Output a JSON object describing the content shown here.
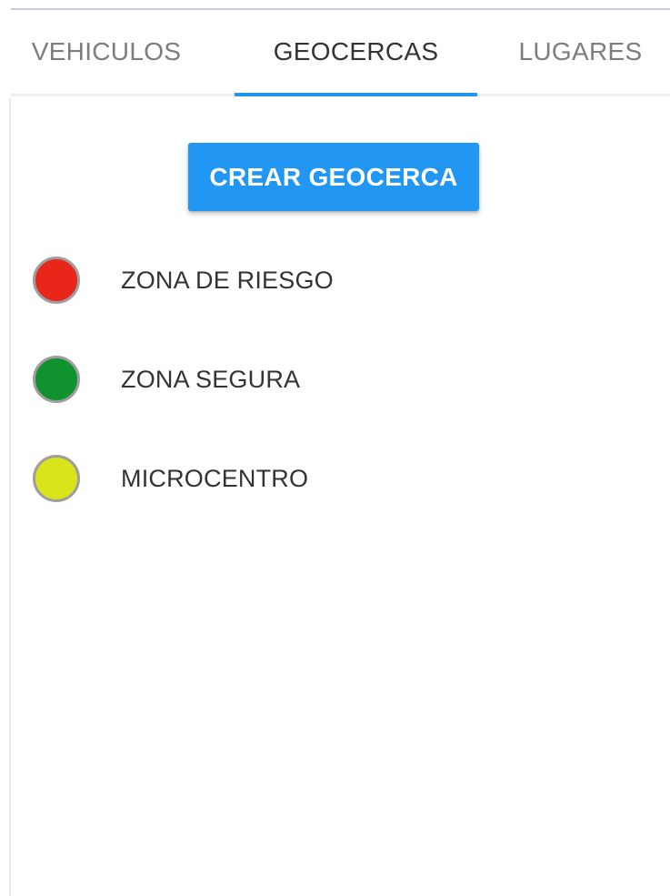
{
  "tabs": [
    {
      "label": "VEHICULOS",
      "active": false
    },
    {
      "label": "GEOCERCAS",
      "active": true
    },
    {
      "label": "LUGARES",
      "active": false
    }
  ],
  "create_button": {
    "label": "CREAR GEOCERCA"
  },
  "geofences": [
    {
      "label": "ZONA DE RIESGO",
      "color": "#e8261a"
    },
    {
      "label": "ZONA SEGURA",
      "color": "#10932e"
    },
    {
      "label": "MICROCENTRO",
      "color": "#d9e41a"
    }
  ],
  "colors": {
    "accent": "#2196f3",
    "active_tab_text": "#333333",
    "inactive_tab_text": "#7d7d7d"
  }
}
